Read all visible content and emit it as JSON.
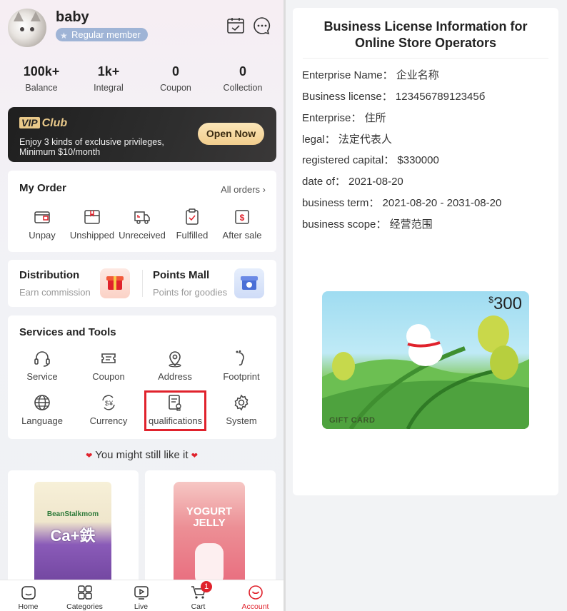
{
  "user": {
    "name": "baby",
    "member_level": "Regular member"
  },
  "header_icons": [
    "calendar-check-icon",
    "chat-bubble-icon"
  ],
  "stats": [
    {
      "value": "100k+",
      "label": "Balance"
    },
    {
      "value": "1k+",
      "label": "Integral"
    },
    {
      "value": "0",
      "label": "Coupon"
    },
    {
      "value": "0",
      "label": "Collection"
    }
  ],
  "vip": {
    "badge": "VIP",
    "title": "Club",
    "desc": "Enjoy 3 kinds of exclusive privileges, Minimum $10/month",
    "button": "Open Now"
  },
  "orders": {
    "title": "My Order",
    "all_label": "All orders",
    "items": [
      {
        "label": "Unpay",
        "icon": "wallet-icon"
      },
      {
        "label": "Unshipped",
        "icon": "gift-box-icon"
      },
      {
        "label": "Unreceived",
        "icon": "delivery-truck-icon"
      },
      {
        "label": "Fulfilled",
        "icon": "clipboard-check-icon"
      },
      {
        "label": "After sale",
        "icon": "refund-icon"
      }
    ]
  },
  "distribution": {
    "title": "Distribution",
    "subtitle": "Earn commission"
  },
  "points_mall": {
    "title": "Points Mall",
    "subtitle": "Points for goodies"
  },
  "services": {
    "title": "Services and Tools",
    "items": [
      {
        "label": "Service",
        "icon": "headset-icon"
      },
      {
        "label": "Coupon",
        "icon": "ticket-icon"
      },
      {
        "label": "Address",
        "icon": "location-pin-icon"
      },
      {
        "label": "Footprint",
        "icon": "footprint-icon"
      },
      {
        "label": "Language",
        "icon": "globe-icon"
      },
      {
        "label": "Currency",
        "icon": "currency-exchange-icon"
      },
      {
        "label": "qualifications",
        "icon": "certificate-document-icon"
      },
      {
        "label": "System",
        "icon": "gear-icon"
      }
    ]
  },
  "recommend": {
    "title": "You might still like it"
  },
  "products": [
    {
      "brand": "BeanStalkmom",
      "name": "Ca+鉄",
      "color": "#7a4fa0"
    },
    {
      "brand": "",
      "name": "YOGURT JELLY",
      "color": "#e8667a"
    }
  ],
  "tabbar": [
    {
      "label": "Home",
      "icon": "home-icon"
    },
    {
      "label": "Categories",
      "icon": "categories-grid-icon"
    },
    {
      "label": "Live",
      "icon": "play-video-icon"
    },
    {
      "label": "Cart",
      "icon": "cart-icon",
      "badge": "1"
    },
    {
      "label": "Account",
      "icon": "account-smile-icon",
      "active": true
    }
  ],
  "license": {
    "title": "Business License Information for Online Store Operators",
    "rows": [
      {
        "label": "Enterprise Name：",
        "value": "企业名称"
      },
      {
        "label": "Business license：",
        "value": "12345678912345б"
      },
      {
        "label": "Enterprise：",
        "value": "住所"
      },
      {
        "label": "legal：",
        "value": "法定代表人"
      },
      {
        "label": "registered capital：",
        "value": "$330000"
      },
      {
        "label": "date of：",
        "value": "2021-08-20"
      },
      {
        "label": "business term：",
        "value": "2021-08-20 - 2031-08-20"
      },
      {
        "label": "business scope：",
        "value": "经营范围"
      }
    ]
  },
  "gift_card": {
    "currency": "$",
    "amount": "300",
    "label": "GIFT CARD"
  },
  "colors": {
    "accent": "#e0222c",
    "vip_gold": "#e9c98a",
    "badge_blue": "#9fb4d6"
  }
}
